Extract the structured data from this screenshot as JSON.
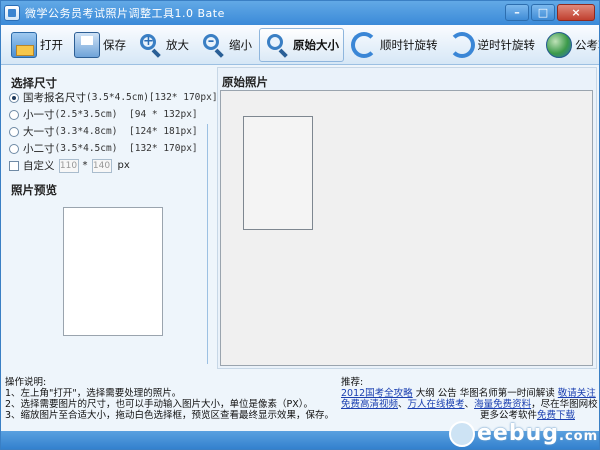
{
  "window": {
    "title": "微学公务员考试照片调整工具1.0 Bate",
    "controls": {
      "minimize": "–",
      "maximize": "□",
      "close": "×"
    }
  },
  "toolbar": {
    "open_label": "打开",
    "save_label": "保存",
    "zoom_in_label": "放大",
    "zoom_out_label": "缩小",
    "original_size_label": "原始大小",
    "rotate_cw_label": "顺时针旋转",
    "rotate_ccw_label": "逆时针旋转",
    "exam_software_label": "公考软件",
    "zoom_in_symbol": "+",
    "zoom_out_symbol": "–"
  },
  "left": {
    "size_title": "选择尺寸",
    "options": [
      {
        "name": "国考报名尺寸",
        "dim": "(3.5*4.5cm)",
        "px": "[132* 170px]",
        "checked": true
      },
      {
        "name": "小一寸",
        "dim": "(2.5*3.5cm)",
        "px": "[94 * 132px]",
        "checked": false
      },
      {
        "name": "大一寸",
        "dim": "(3.3*4.8cm)",
        "px": "[124* 181px]",
        "checked": false
      },
      {
        "name": "小二寸",
        "dim": "(3.5*4.5cm)",
        "px": "[132* 170px]",
        "checked": false
      }
    ],
    "custom": {
      "label": "自定义",
      "width": "110",
      "times": "*",
      "height": "140",
      "unit": "px"
    },
    "preview_title": "照片预览"
  },
  "right": {
    "original_title": "原始照片"
  },
  "instructions": {
    "heading": "操作说明:",
    "lines": [
      "1、左上角\"打开\"，选择需要处理的照片。",
      "2、选择需要图片的尺寸，也可以手动输入图片大小，单位是像素（PX）。",
      "3、缩放图片至合适大小，拖动白色选择框，预览区查看最终显示效果，保存。"
    ]
  },
  "recommend": {
    "heading": "推荐:",
    "line1": {
      "link1": "2012国考全攻略",
      "text1": " 大纲 公告 华图名师第一时间解读 ",
      "link2": "敬请关注"
    },
    "line2": {
      "link1": "免费高清视频",
      "sep": "、",
      "link2": "万人在线模考",
      "sep2": "、",
      "link3": "海量免费资料",
      "text": "，尽在华图网校"
    },
    "line3": {
      "text": "更多公考软件",
      "link": "免费下载"
    }
  },
  "watermark": {
    "text": "eebug",
    "suffix": ".com"
  },
  "colors": {
    "title_bar": "#3b8ad8",
    "status_bar": "#2f7dcc",
    "link": "#1a3fb0",
    "panel_bg": "#eef5fb"
  }
}
